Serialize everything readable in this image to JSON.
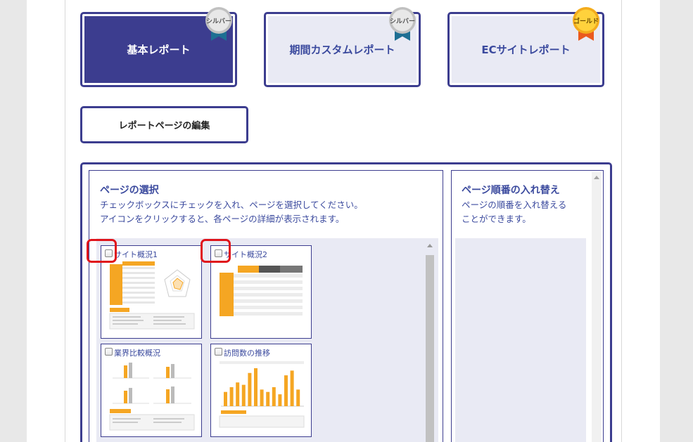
{
  "reports": [
    {
      "label": "基本レポート",
      "badge": "シルバー"
    },
    {
      "label": "期間カスタムレポート",
      "badge": "シルバー"
    },
    {
      "label": "ECサイトレポート",
      "badge": "ゴールド"
    }
  ],
  "edit_button": "レポートページの編集",
  "select_panel": {
    "title": "ページの選択",
    "desc_line1": "チェックボックスにチェックを入れ、ページを選択してください。",
    "desc_line2": "アイコンをクリックすると、各ページの詳細が表示されます。"
  },
  "pages": [
    {
      "title": "サイト概況1"
    },
    {
      "title": "サイト概況2"
    },
    {
      "title": "業界比較概況"
    },
    {
      "title": "訪問数の推移"
    }
  ],
  "order_panel": {
    "title": "ページ順番の入れ替え",
    "desc_line1": "ページの順番を入れ替える",
    "desc_line2": "ことができます。"
  },
  "colors": {
    "accent": "#3c3d8f",
    "text_blue": "#3b4a9e",
    "panel_bg": "#e9eaf4",
    "highlight_red": "#e0141b",
    "thumb_orange": "#f5a623"
  },
  "chart_data": {
    "type": "bar",
    "values": [
      6,
      8,
      10,
      9,
      14,
      16,
      7,
      6,
      8,
      5,
      13,
      15,
      7
    ]
  }
}
